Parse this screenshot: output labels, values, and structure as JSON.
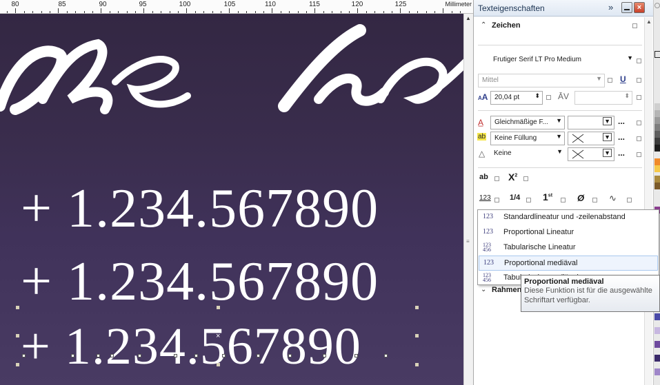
{
  "ruler": {
    "numbers": [
      "80",
      "85",
      "90",
      "95",
      "100",
      "105",
      "110",
      "115",
      "120",
      "125"
    ],
    "unit": "Millimeter"
  },
  "canvas": {
    "script_text": "sse Ka",
    "number_line_1": "+ 1.234.567890",
    "number_line_2": "+ 1.234.567890",
    "number_line_3": "+ 1.234.567890"
  },
  "docker": {
    "title": "Texteigenschaften",
    "section_title": "Zeichen",
    "font_name": "Frutiger Serif LT Pro Medium",
    "font_style": "Mittel",
    "font_size": "20,04 pt",
    "fill_type": "Gleichmäßige F...",
    "background_fill": "Keine Füllung",
    "outline": "Keine",
    "more": "...",
    "next_section": "Rahmen",
    "icons": {
      "font": "opentype-icon",
      "underline": "underline-icon",
      "size": "font-size-icon",
      "kerning": "kerning-icon",
      "fill": "text-fill-icon",
      "bgfill": "background-fill-icon",
      "outline": "outline-pen-icon"
    },
    "feature_row_1": [
      "ab",
      "X"
    ],
    "feature_row_2": [
      "123",
      "1/4",
      "1st",
      "0",
      "swash"
    ],
    "superscript_mark": "2",
    "ordinal_mark": "st"
  },
  "dropdown": {
    "items": [
      {
        "icon": "123",
        "label": "Standardlineatur und -zeilenabstand"
      },
      {
        "icon": "123",
        "label": "Proportional Lineatur"
      },
      {
        "icon": "123 456",
        "label": "Tabularische Lineatur"
      },
      {
        "icon": "123",
        "label": "Proportional mediäval"
      },
      {
        "icon": "123 456",
        "label": "Tabularische mediäval"
      }
    ],
    "selected_index": 3
  },
  "tooltip": {
    "title": "Proportional mediäval",
    "line1": "Diese Funktion ist für die ausgewählte",
    "line2": "Schriftart verfügbar."
  },
  "colors": {
    "canvas_top": "#332743",
    "canvas_bottom": "#493b63",
    "selection_highlight": "#eef4fd",
    "close_button": "#c8402a"
  }
}
